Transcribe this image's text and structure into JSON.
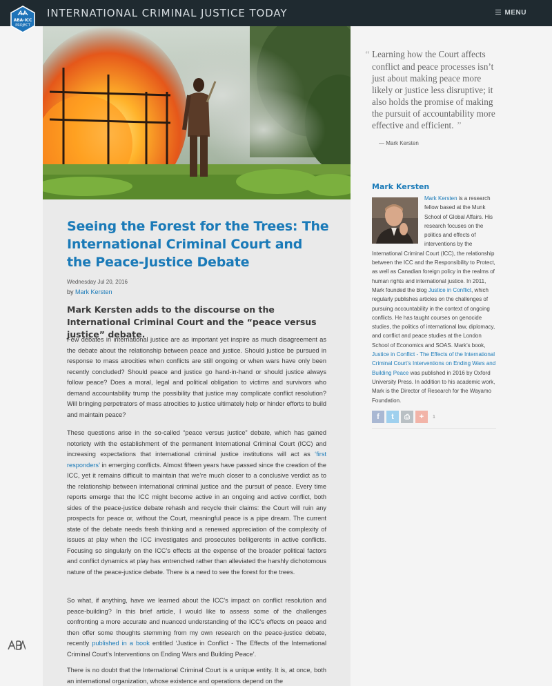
{
  "header": {
    "logo_text": "ABA-ICC PROJECT",
    "site_title": "INTERNATIONAL CRIMINAL JUSTICE TODAY",
    "menu_label": "MENU"
  },
  "article": {
    "title": "Seeing the Forest for the Trees: The International Criminal Court and the Peace-Justice Debate",
    "date": "Wednesday Jul 20, 2016",
    "by_prefix": "by ",
    "author": "Mark Kersten",
    "lede": "Mark Kersten adds to the discourse on the International Criminal Court and the “peace versus justice” debate.",
    "p1": "Few debates in international justice are as important yet inspire as much disagreement as the debate about the relationship between peace and justice. Should justice be pursued in response to mass atrocities when conflicts are still ongoing or when wars have only been recently concluded? Should peace and justice go hand-in-hand or should justice always follow peace? Does a moral, legal and political obligation to victims and survivors who demand accountability trump the possibility that justice may complicate conflict resolution? Will bringing perpetrators of mass atrocities to justice ultimately help or hinder efforts to build and maintain peace?",
    "p2_a": "These questions arise in the so-called “peace versus justice” debate, which has gained notoriety with the establishment of the permanent International Criminal Court (ICC) and increasing expectations that international criminal justice institutions will act as ",
    "p2_link": "‘first responders’",
    "p2_b": " in emerging conflicts. Almost fifteen years have passed since the creation of the ICC, yet it remains difficult to maintain that we’re much closer to a conclusive verdict as to the relationship between international criminal justice and the pursuit of peace. Every time reports emerge that the ICC might become active in an ongoing and active conflict, both sides of the peace-justice debate rehash and recycle their claims: the Court will ruin any prospects for peace or, without the Court, meaningful peace is a pipe dream. The current state of the debate needs fresh thinking and a renewed appreciation of the complexity of issues at play when the ICC investigates and prosecutes belligerents in active conflicts. Focusing so singularly on the ICC’s effects at the expense of the broader political factors and conflict dynamics at play has entrenched rather than alleviated the harshly dichotomous nature of the peace-justice debate. There is a need to see the forest for the trees.",
    "p3_a": "So what, if anything, have we learned about the ICC’s impact on conflict resolution and peace-building? In this brief article, I would like to assess some of the challenges confronting a more accurate and nuanced understanding of the ICC’s effects on peace and then offer some thoughts stemming from my own research on the peace-justice debate, recently ",
    "p3_link": "published in a book",
    "p3_b": " entitled ‘Justice in Conflict - The Effects of the International Criminal Court’s Interventions on Ending Wars and Building Peace’.",
    "p4": "There is no doubt that the International Criminal Court is a unique entity. It is, at once, both an international organization, whose existence and operations depend on the"
  },
  "pullquote": {
    "open": "“",
    "text": "Learning how the Court affects conflict and peace processes isn’t just about making peace more likely or justice less disruptive; it also holds the promise of making the pursuit of accountability more effective and efficient.",
    "close": "”",
    "cite": "— Mark Kersten"
  },
  "author_box": {
    "heading": "Mark Kersten",
    "name_link": "Mark Kersten",
    "bio_a": " is a research fellow based at the Munk School of Global Affairs. His research focuses on the politics and effects of interventions by the International Criminal Court (ICC), the relationship between the ICC and the Responsibility to Protect, as well as Canadian foreign policy in the realms of human rights and international justice. In 2011, Mark founded the blog ",
    "blog_link": "Justice in Conflict",
    "bio_b": ", which regularly publishes articles on the challenges of pursuing accountability in the context of ongoing conflicts. He has taught courses on genocide studies, the politics of international law, diplomacy, and conflict and peace studies at the London School of Economics and SOAS. Mark’s book, ",
    "book_link": "Justice in Conflict - The Effects of the International Criminal Court’s Interventions on Ending Wars and Building Peace",
    "bio_c": " was published in 2016 by Oxford University Press. In addition to his academic work, Mark is the Director of Research for the Wayamo Foundation."
  },
  "share": {
    "facebook_glyph": "f",
    "twitter_glyph": "t",
    "print_glyph": "⎙",
    "more_glyph": "+",
    "count": "1"
  },
  "colors": {
    "topbar": "#1f2a30",
    "accent_blue": "#1a7ab8",
    "article_bg": "#eaeaea",
    "page_bg": "#f4f4f4"
  },
  "icons": [
    "aba-icc-logo-icon",
    "menu-icon",
    "facebook-icon",
    "twitter-icon",
    "print-icon",
    "share-more-icon",
    "aba-footer-logo-icon"
  ]
}
